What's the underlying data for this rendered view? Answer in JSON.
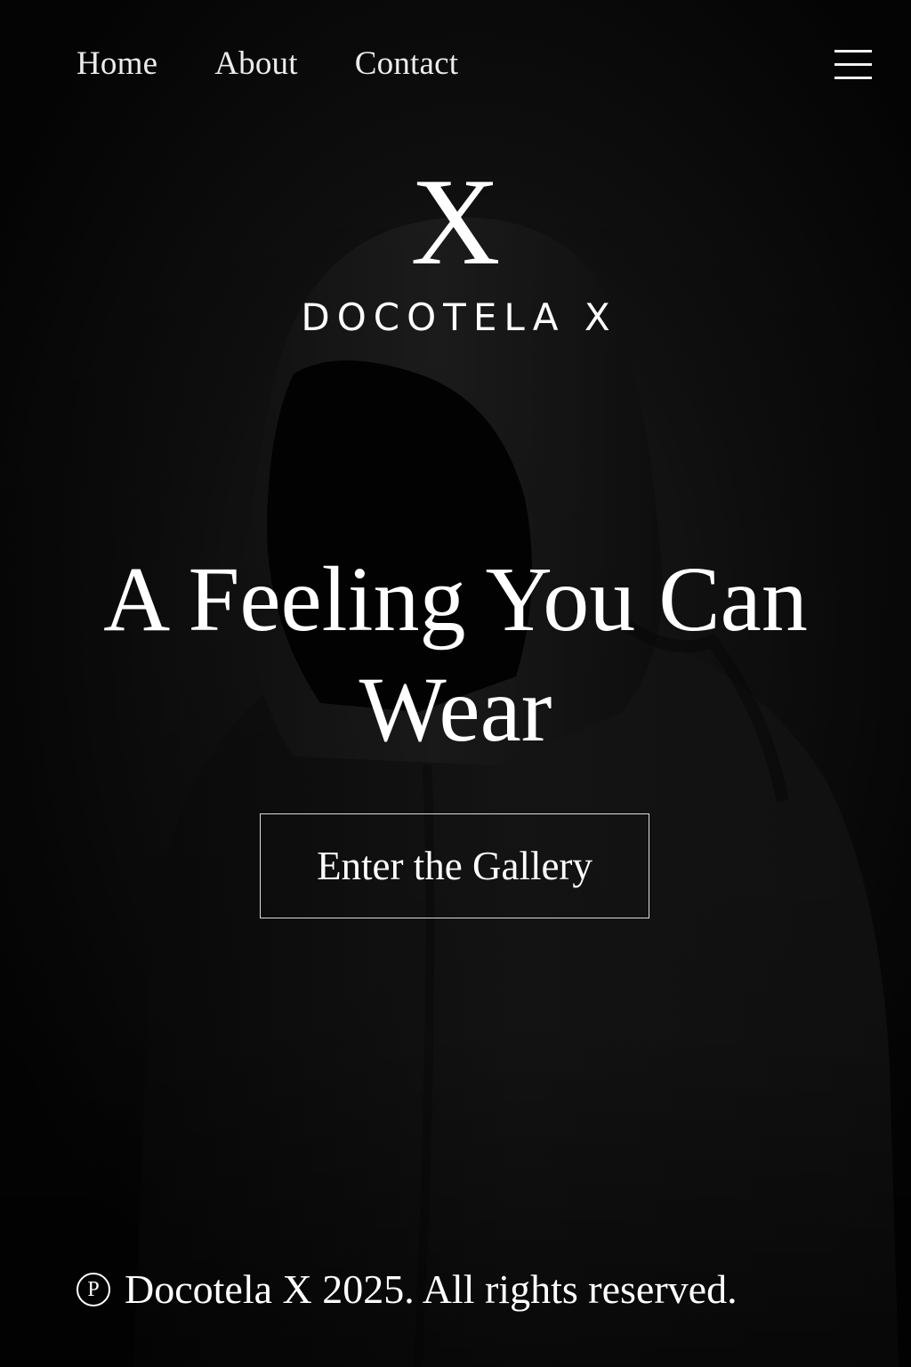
{
  "nav": {
    "items": [
      {
        "label": "Home"
      },
      {
        "label": "About"
      },
      {
        "label": "Contact"
      }
    ],
    "menu_icon": "hamburger-menu-icon"
  },
  "brand": {
    "mark": "X",
    "name": "DOCOTELA X"
  },
  "hero": {
    "title_line1": "A Feeling You Can",
    "title_line2": "Wear",
    "cta_label": "Enter the Gallery",
    "image": "hooded-figure-photo"
  },
  "footer": {
    "symbol": "P",
    "text": "Docotela X 2025. All rights reserved."
  },
  "colors": {
    "background": "#050505",
    "text": "#ffffff",
    "button_border": "#dcdcdc"
  }
}
